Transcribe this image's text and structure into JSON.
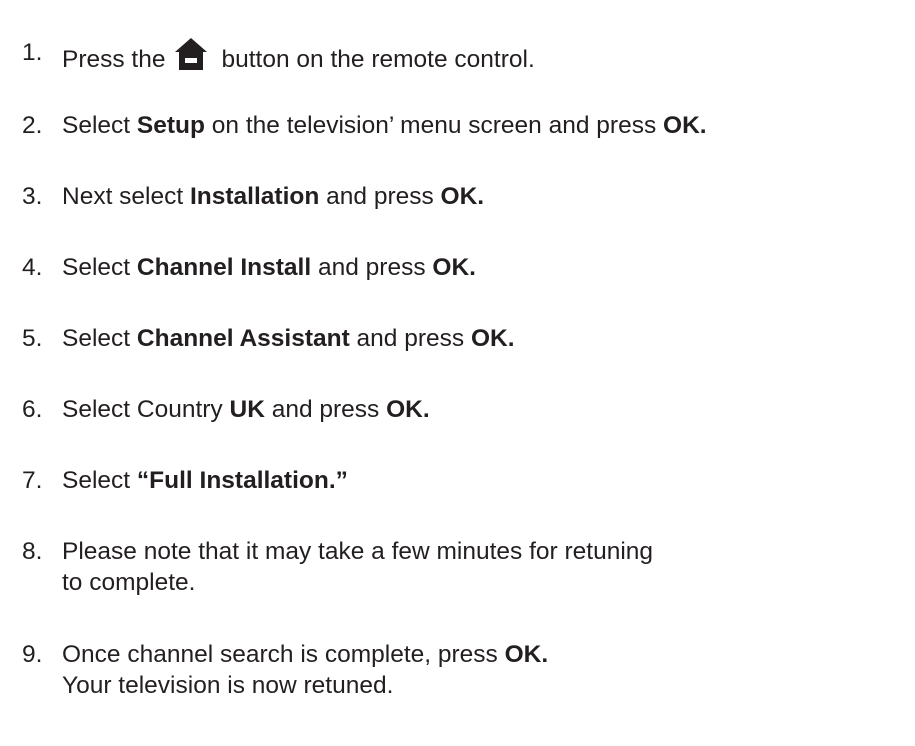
{
  "steps": [
    {
      "number": "1.",
      "before_icon": "Press the",
      "icon": "home-icon",
      "after_icon": "button on the remote control."
    },
    {
      "number": "2.",
      "parts": [
        "Select ",
        "Setup",
        " on the television’ menu screen and press ",
        "OK."
      ]
    },
    {
      "number": "3.",
      "parts": [
        "Next select ",
        "Installation",
        " and press ",
        "OK."
      ]
    },
    {
      "number": "4.",
      "parts": [
        "Select ",
        "Channel Install",
        " and press ",
        "OK."
      ]
    },
    {
      "number": "5.",
      "parts": [
        "Select ",
        "Channel Assistant",
        " and press ",
        "OK."
      ]
    },
    {
      "number": "6.",
      "parts": [
        "Select Country ",
        "UK",
        " and press ",
        "OK."
      ]
    },
    {
      "number": "7.",
      "parts": [
        "Select ",
        "“Full Installation.”"
      ]
    },
    {
      "number": "8.",
      "line1": "Please note that it may take a few minutes for retuning",
      "line2": "to complete."
    },
    {
      "number": "9.",
      "parts": [
        "Once channel search is complete, press ",
        "OK."
      ],
      "line2": "Your television is now retuned."
    }
  ],
  "colors": {
    "text": "#231f20",
    "background": "#ffffff"
  }
}
